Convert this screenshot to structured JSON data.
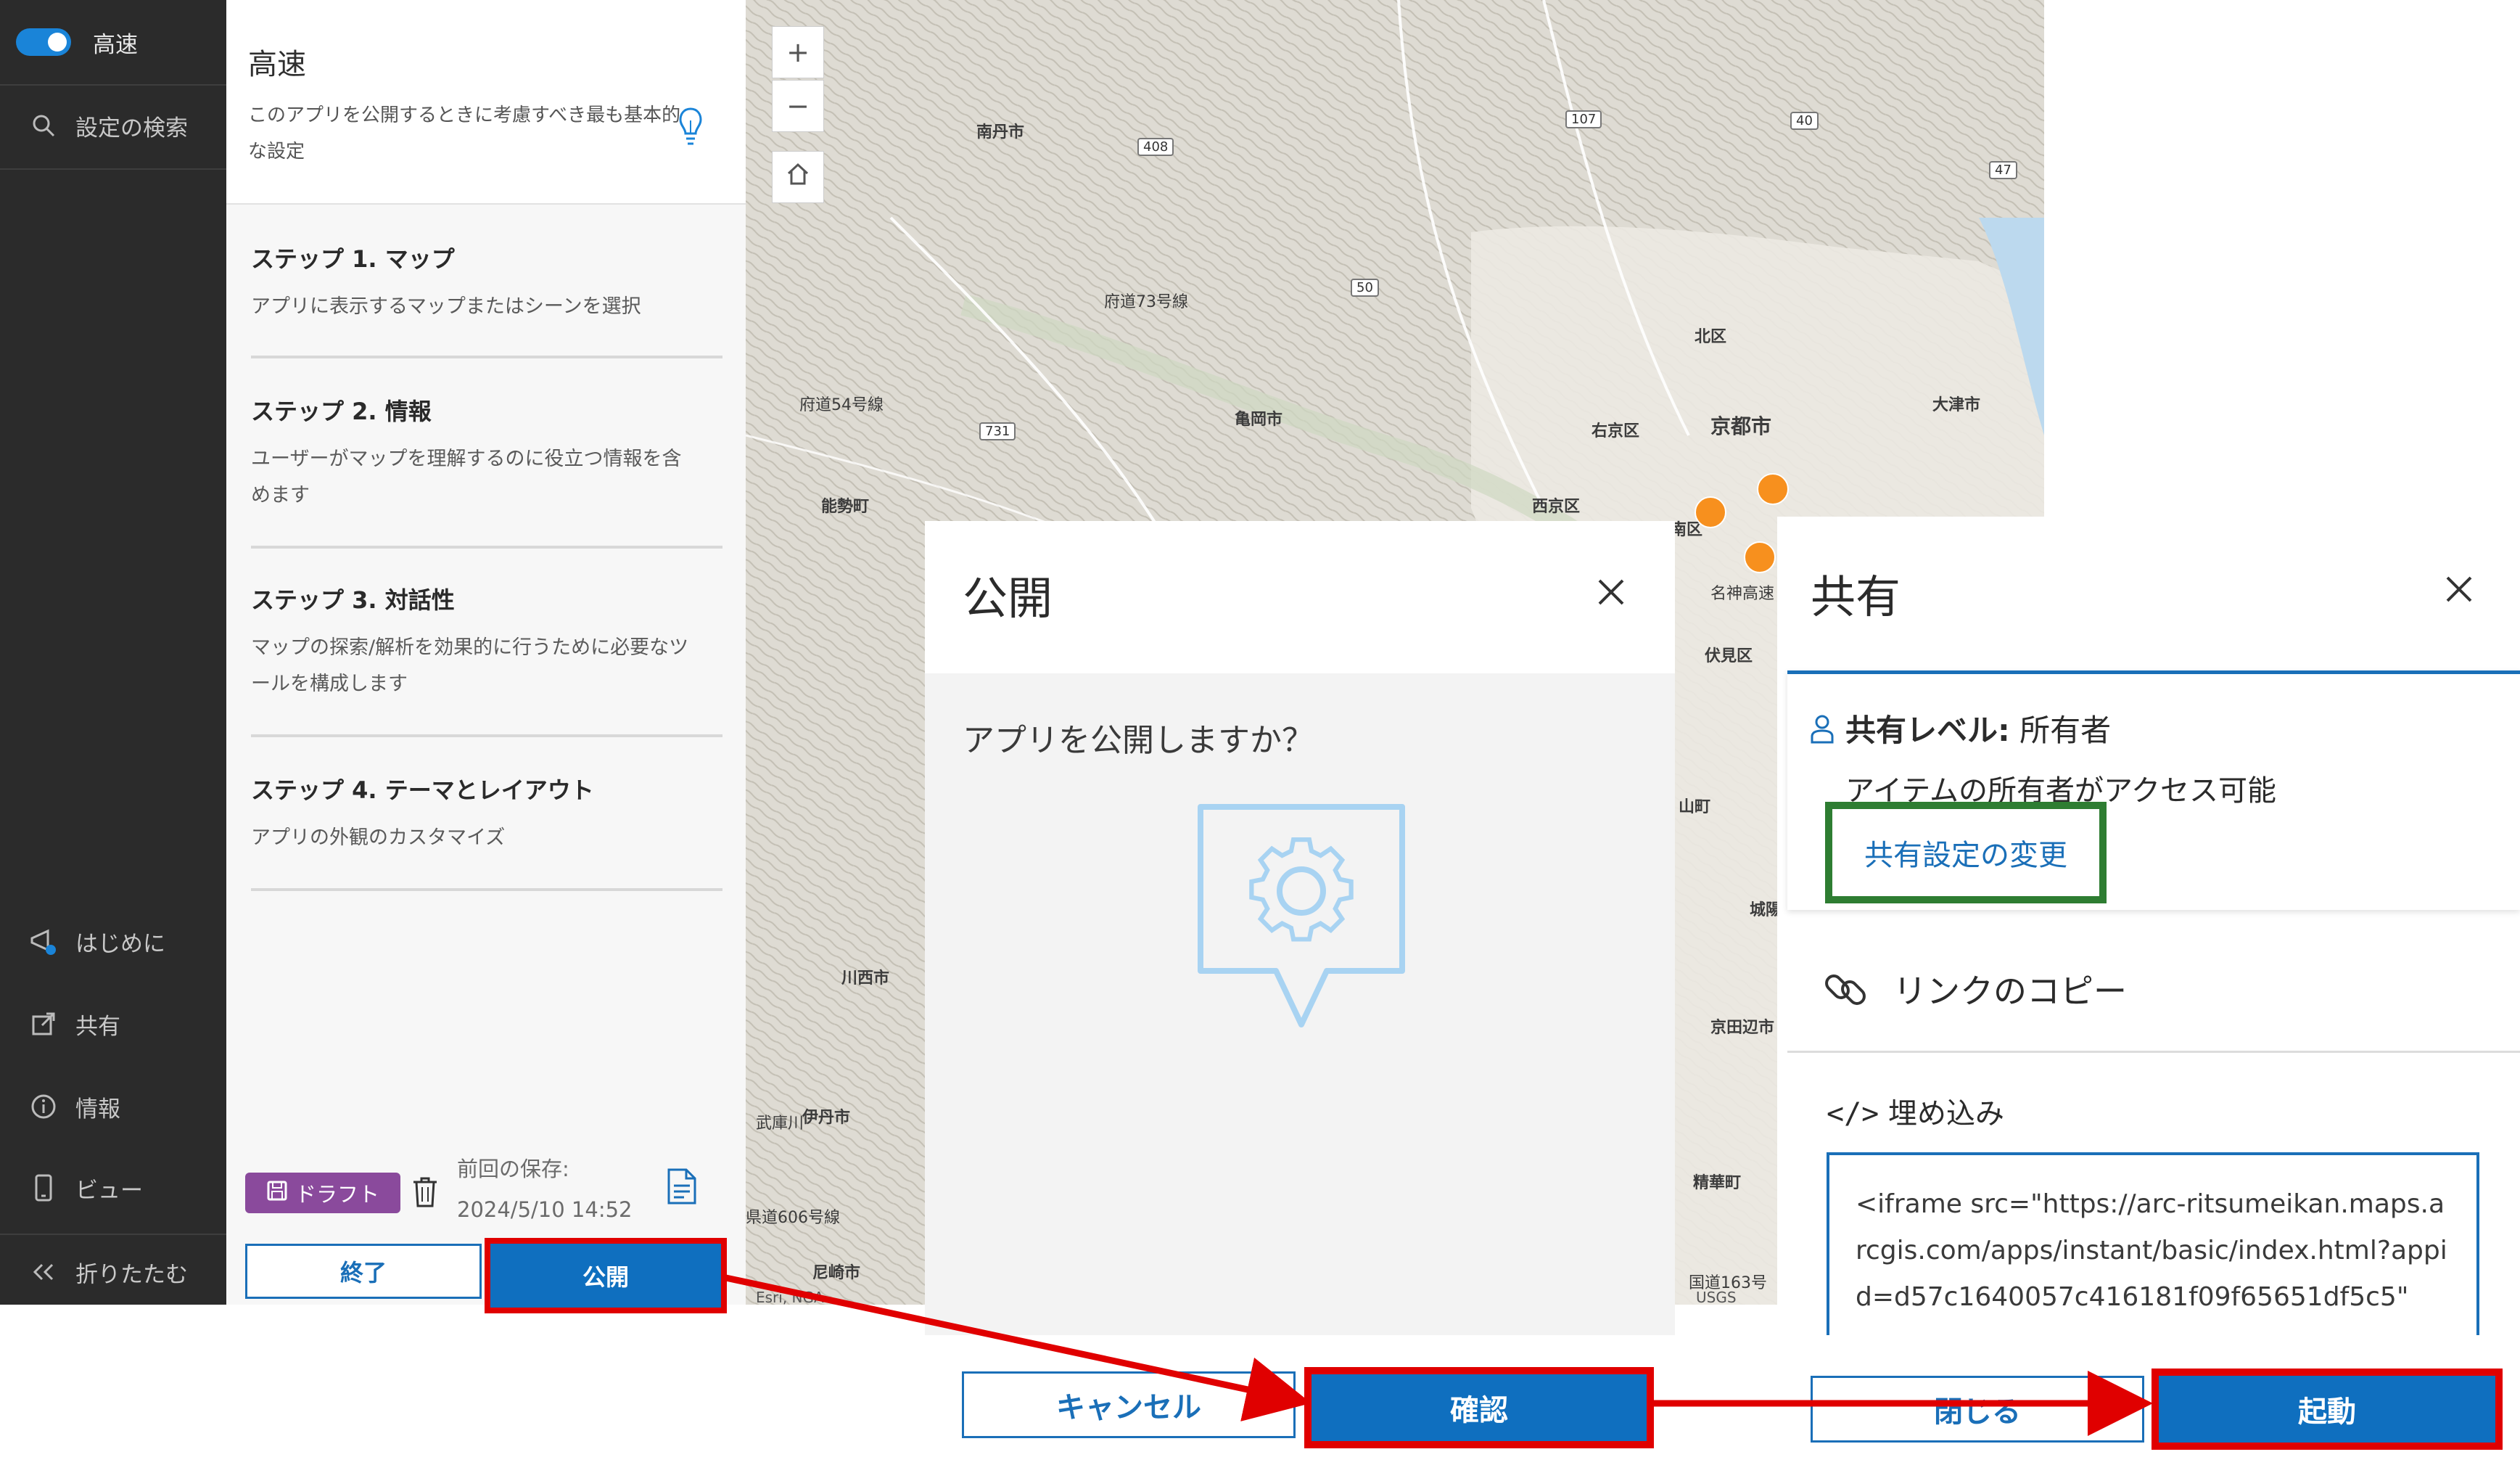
{
  "rail": {
    "toggle_label": "高速",
    "search_label": "設定の検索",
    "items": [
      {
        "label": "はじめに",
        "icon": "megaphone-icon"
      },
      {
        "label": "共有",
        "icon": "share-icon"
      },
      {
        "label": "情報",
        "icon": "info-icon"
      },
      {
        "label": "ビュー",
        "icon": "mobile-icon"
      }
    ],
    "collapse_label": "折りたたむ"
  },
  "panel": {
    "title": "高速",
    "description": "このアプリを公開するときに考慮すべき最も基本的な設定",
    "steps": [
      {
        "title": "ステップ 1. マップ",
        "desc": "アプリに表示するマップまたはシーンを選択"
      },
      {
        "title": "ステップ 2. 情報",
        "desc": "ユーザーがマップを理解するのに役立つ情報を含めます"
      },
      {
        "title": "ステップ 3. 対話性",
        "desc": "マップの探索/解析を効果的に行うために必要なツールを構成します"
      },
      {
        "title": "ステップ 4. テーマとレイアウト",
        "desc": "アプリの外観のカスタマイズ"
      }
    ],
    "draft_label": "ドラフト",
    "save_label": "前回の保存:",
    "save_time": "2024/5/10 14:52",
    "end_button": "終了",
    "publish_button": "公開"
  },
  "map": {
    "zoom_in": "+",
    "zoom_out": "−",
    "labels": [
      "南丹市",
      "府道73号線",
      "亀岡市",
      "府道54号線",
      "能勢町",
      "北区",
      "右京区",
      "京都市",
      "大津市",
      "西京区",
      "南区",
      "名神高速",
      "伏見区",
      "山町",
      "川西市",
      "伊丹市",
      "城陽",
      "京田辺市",
      "精華町",
      "尼崎市",
      "県道606号線",
      "国道163号",
      "武庫川"
    ],
    "roads": [
      "408",
      "107",
      "40",
      "47",
      "50",
      "731"
    ],
    "attribution_left": "Esri, NGA",
    "attribution_right": "USGS"
  },
  "publish_dialog": {
    "title": "公開",
    "question": "アプリを公開しますか？",
    "cancel_button": "キャンセル",
    "confirm_button": "確認"
  },
  "share_dialog": {
    "title": "共有",
    "level_label": "共有レベル:",
    "level_value": "所有者",
    "level_desc": "アイテムの所有者がアクセス可能",
    "change_link": "共有設定の変更",
    "copy_link": "リンクのコピー",
    "embed_label": "埋め込み",
    "embed_code": "<iframe src=\"https://arc-ritsumeikan.maps.arcgis.com/apps/instant/basic/index.html?appid=d57c1640057c416181f09f65651df5c5\"",
    "close_button": "閉じる",
    "launch_button": "起動"
  },
  "colors": {
    "accent": "#0f6fbf",
    "highlight_red": "#e00000",
    "highlight_green": "#2e7d32",
    "draft_purple": "#8a4a9c",
    "rail_dark": "#2b2b2b",
    "map_dot": "#f7901e"
  }
}
